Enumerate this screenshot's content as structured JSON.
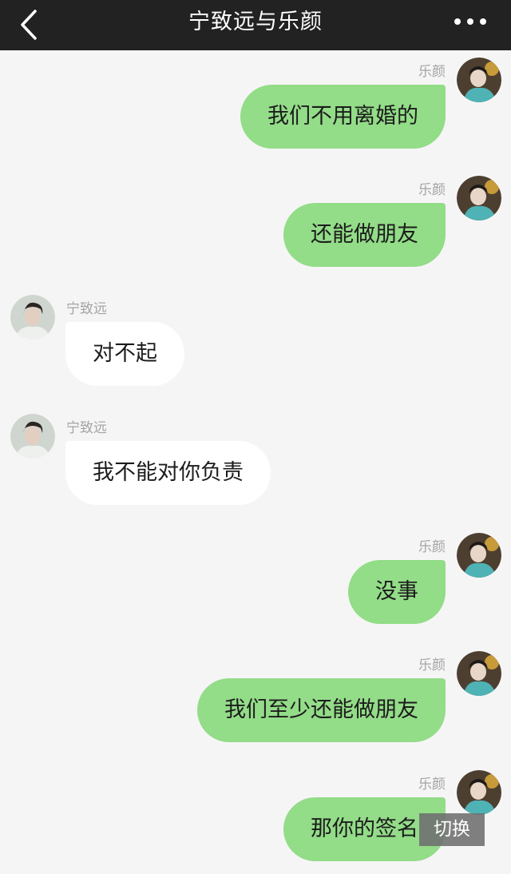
{
  "header": {
    "title": "宁致远与乐颜",
    "back_icon": "chevron-left-icon",
    "more_icon": "ellipsis-icon"
  },
  "messages": [
    {
      "side": "right",
      "sender": "乐颜",
      "text": "我们不用离婚的"
    },
    {
      "side": "right",
      "sender": "乐颜",
      "text": "还能做朋友"
    },
    {
      "side": "left",
      "sender": "宁致远",
      "text": "对不起"
    },
    {
      "side": "left",
      "sender": "宁致远",
      "text": "我不能对你负责"
    },
    {
      "side": "right",
      "sender": "乐颜",
      "text": "没事"
    },
    {
      "side": "right",
      "sender": "乐颜",
      "text": "我们至少还能做朋友"
    },
    {
      "side": "right",
      "sender": "乐颜",
      "text": "那你的签名"
    }
  ],
  "switch_button": {
    "label": "切换"
  },
  "colors": {
    "header_bg": "#222222",
    "page_bg": "#f6f5f6",
    "right_bubble": "#93dc88",
    "left_bubble": "#ffffff",
    "name_text": "#a3a3a3"
  }
}
